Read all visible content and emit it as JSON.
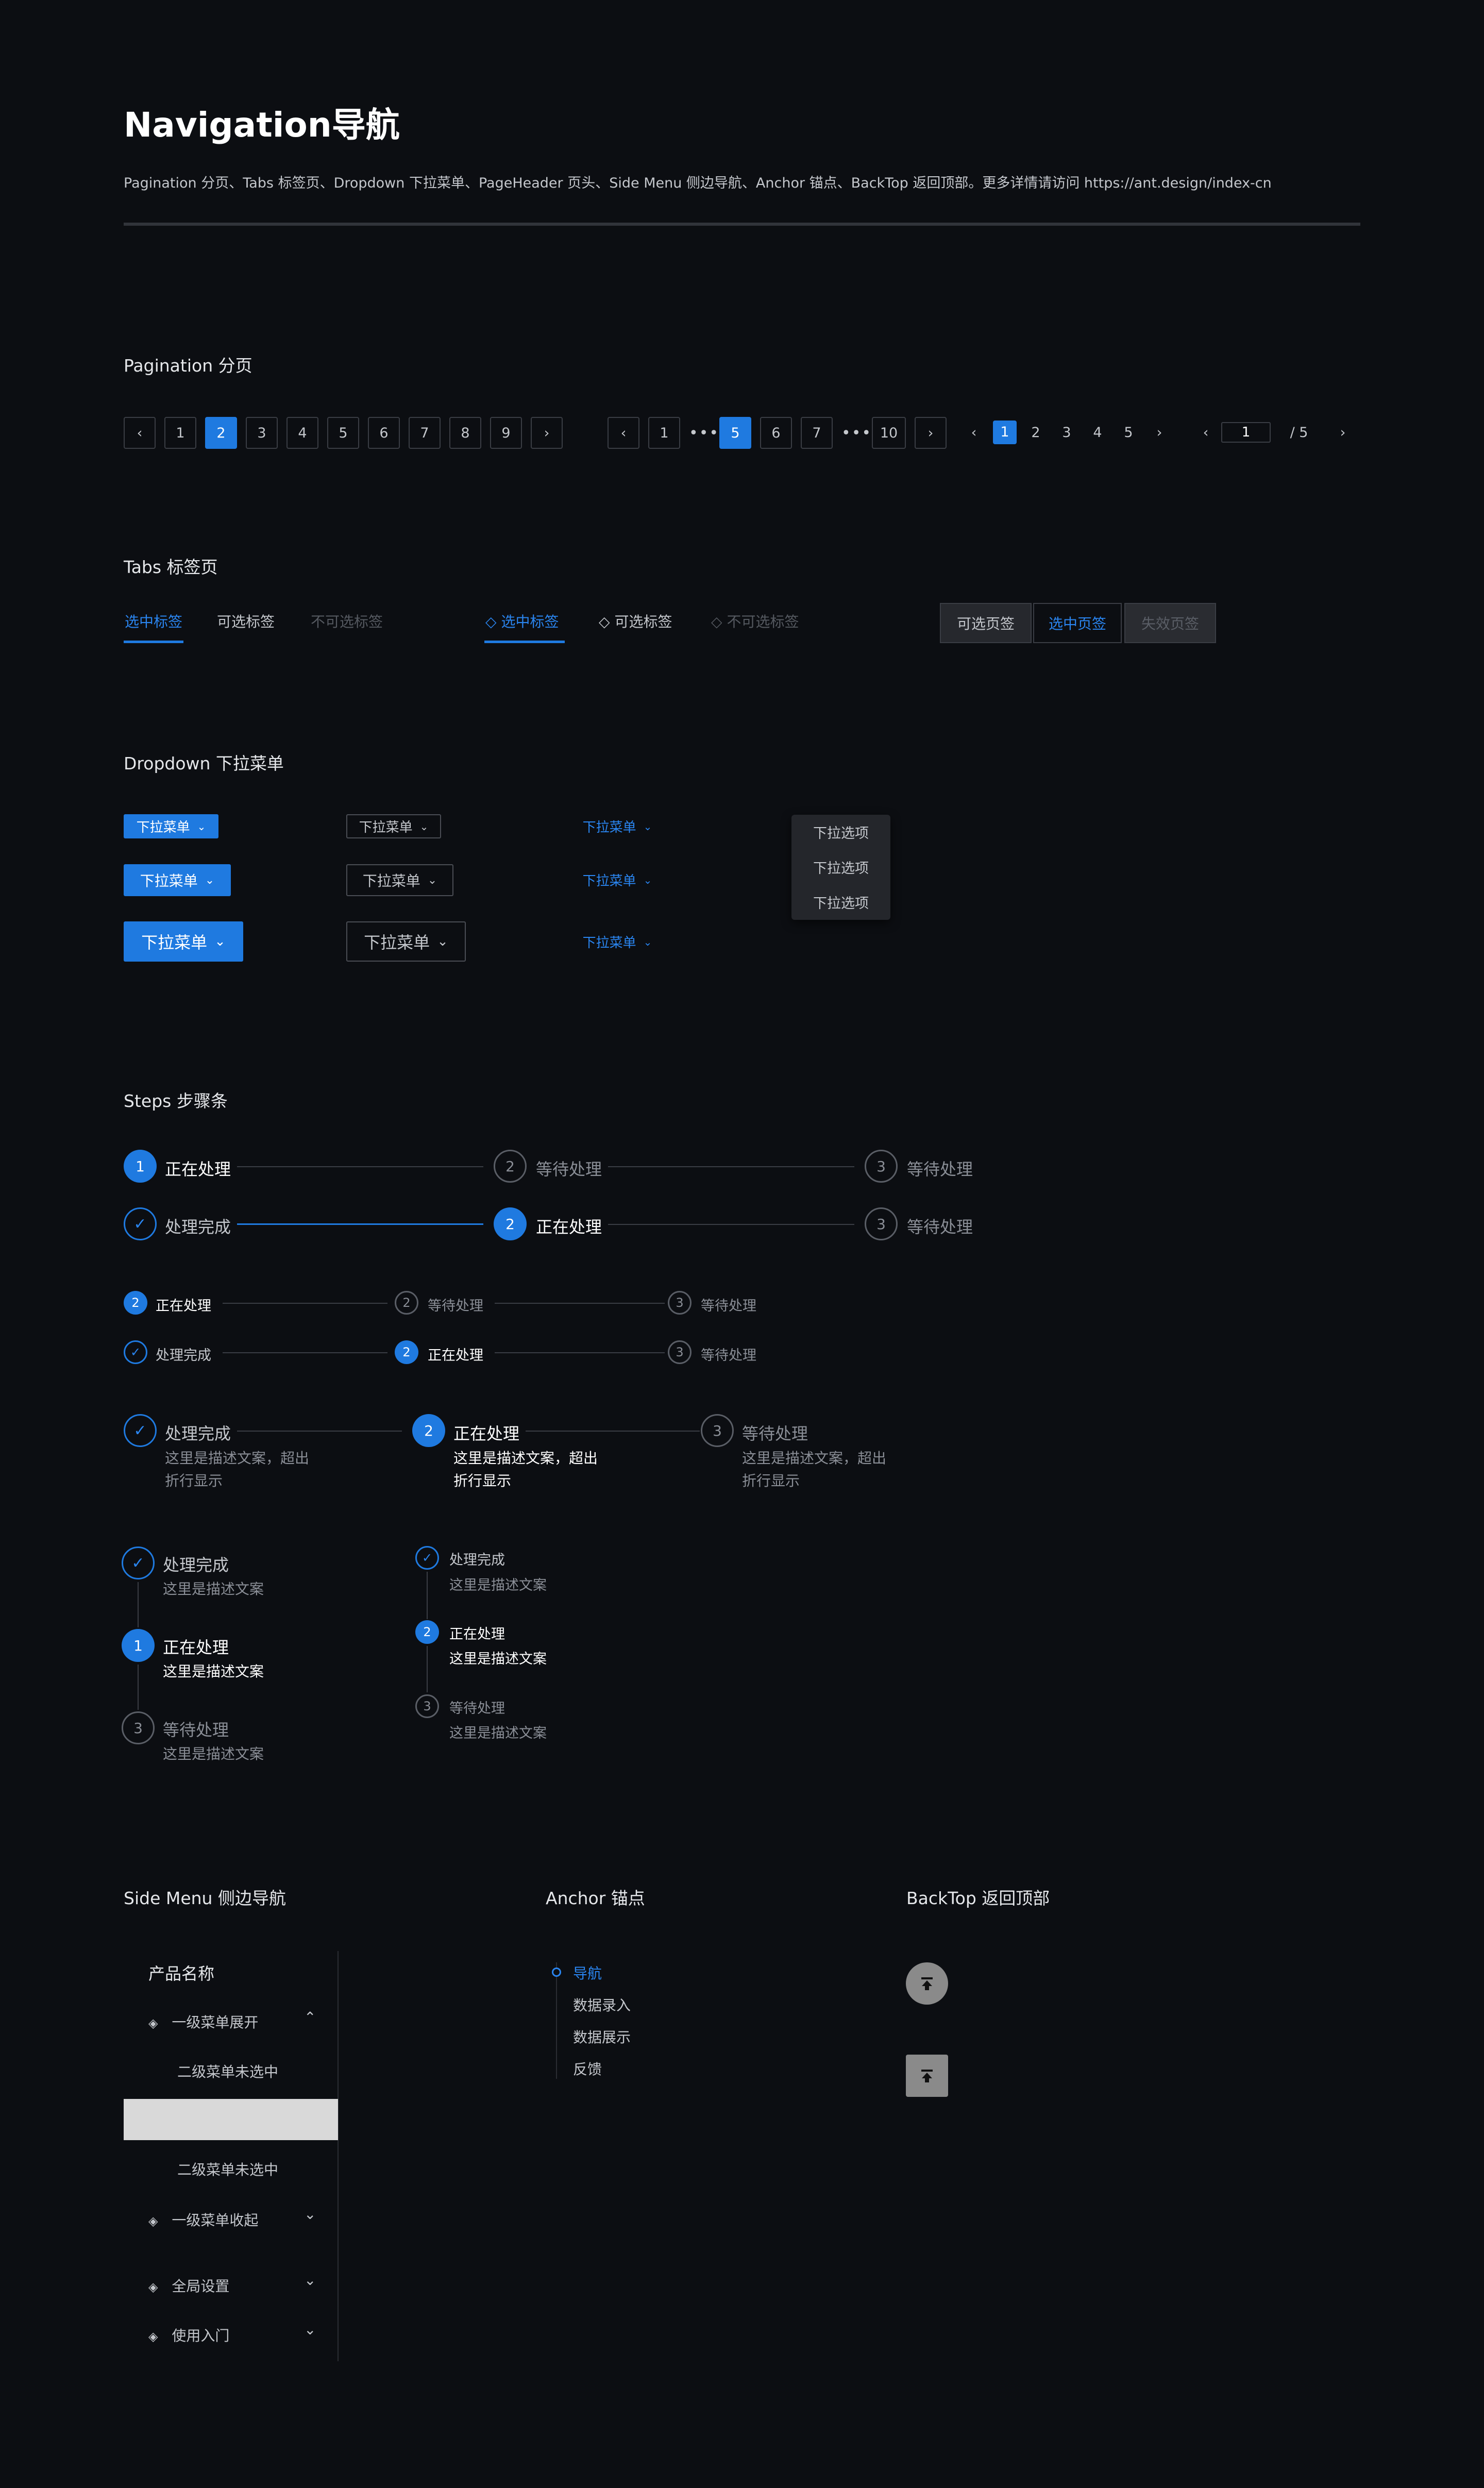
{
  "header": {
    "title": "Navigation导航",
    "subtitle": "Pagination 分页、Tabs 标签页、Dropdown 下拉菜单、PageHeader 页头、Side Menu 侧边导航、Anchor 锚点、BackTop 返回顶部。更多详情请访问 https://ant.design/index-cn"
  },
  "pagination": {
    "title": "Pagination 分页",
    "group1": [
      "1",
      "2",
      "3",
      "4",
      "5",
      "6",
      "7",
      "8",
      "9"
    ],
    "group1_active": "2",
    "group2_first": "1",
    "group2_mid": [
      "5",
      "6",
      "7"
    ],
    "group2_last": "10",
    "group2_active": "5",
    "dots": "•••",
    "group3": [
      "1",
      "2",
      "3",
      "4",
      "5"
    ],
    "group3_active": "1",
    "jumper_value": "1",
    "jumper_total": "/ 5",
    "prev": "‹",
    "next": "›"
  },
  "tabs": {
    "title": "Tabs 标签页",
    "line": {
      "selected": "选中标签",
      "normal": "可选标签",
      "disabled": "不可选标签"
    },
    "icon": {
      "selected": "选中标签",
      "normal": "可选标签",
      "disabled": "不可选标签"
    },
    "card": {
      "normal": "可选页签",
      "selected": "选中页签",
      "disabled": "失效页签"
    }
  },
  "dropdown": {
    "title": "Dropdown 下拉菜单",
    "label": "下拉菜单",
    "options": [
      "下拉选项",
      "下拉选项",
      "下拉选项"
    ]
  },
  "steps": {
    "title": "Steps 步骤条",
    "processing": "正在处理",
    "waiting": "等待处理",
    "done": "处理完成",
    "desc_long_1": "这里是描述文案，超出",
    "desc_long_2": "折行显示",
    "desc_short": "这里是描述文案",
    "n1": "1",
    "n2": "2",
    "n3": "3"
  },
  "side_menu": {
    "title": "Side Menu 侧边导航",
    "product": "产品名称",
    "expanded": "一级菜单展开",
    "sub1": "二级菜单未选中",
    "sub2": "二级菜单未选中",
    "collapsed": "一级菜单收起",
    "settings": "全局设置",
    "guide": "使用入门"
  },
  "anchor": {
    "title": "Anchor 锚点",
    "items": [
      "导航",
      "数据录入",
      "数据展示",
      "反馈"
    ]
  },
  "backtop": {
    "title": "BackTop 返回顶部"
  },
  "colors": {
    "primary": "#1f7ae0",
    "background": "#0c0e12"
  }
}
